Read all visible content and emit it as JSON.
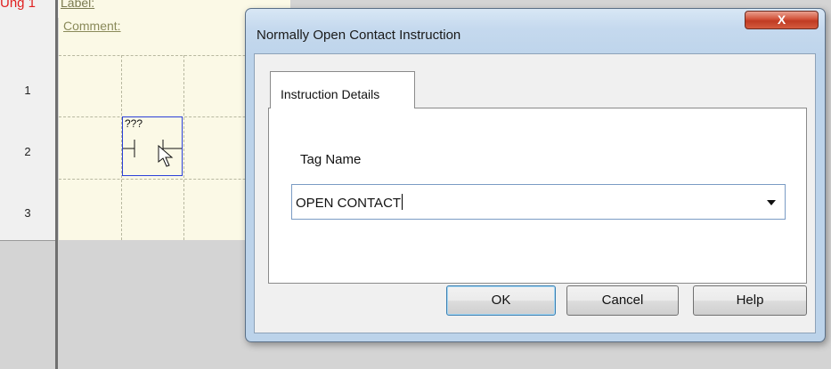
{
  "editor": {
    "rung_label": "Ung 1",
    "label_field": "Label:",
    "comment_field": "Comment:",
    "rows": [
      "1",
      "2",
      "3"
    ],
    "contact_tag": "???"
  },
  "dialog": {
    "title": "Normally Open Contact Instruction",
    "close_glyph": "X",
    "tab_label": "Instruction Details",
    "field_label": "Tag Name",
    "tag_value": "OPEN CONTACT",
    "buttons": {
      "ok": "OK",
      "cancel": "Cancel",
      "help": "Help"
    }
  },
  "colors": {
    "rung_label": "#e02020",
    "selection_border": "#2a3fd8",
    "close_button": "#c8452c"
  }
}
